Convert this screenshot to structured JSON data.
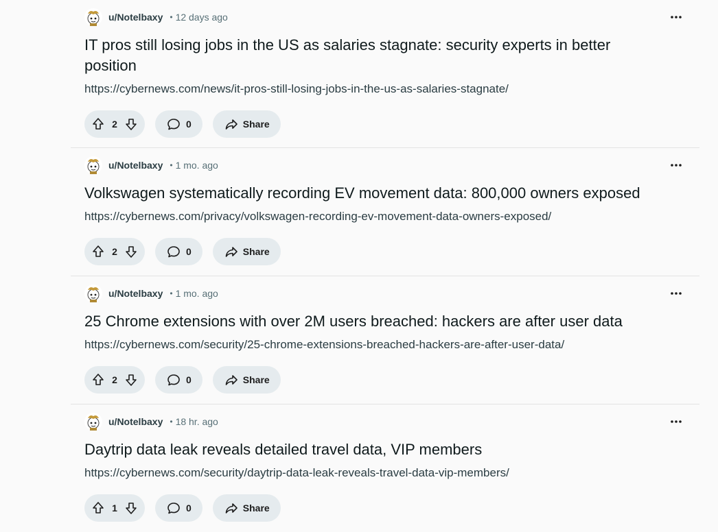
{
  "posts": [
    {
      "author": "u/Notelbaxy",
      "separator": "•",
      "time": "12 days ago",
      "title": "IT pros still losing jobs in the US as salaries stagnate: security experts in better position",
      "url": "https://cybernews.com/news/it-pros-still-losing-jobs-in-the-us-as-salaries-stagnate/",
      "votes": "2",
      "comments": "0",
      "share_label": "Share",
      "more": "•••"
    },
    {
      "author": "u/Notelbaxy",
      "separator": "•",
      "time": "1 mo. ago",
      "title": "Volkswagen systematically recording EV movement data: 800,000 owners exposed",
      "url": "https://cybernews.com/privacy/volkswagen-recording-ev-movement-data-owners-exposed/",
      "votes": "2",
      "comments": "0",
      "share_label": "Share",
      "more": "•••"
    },
    {
      "author": "u/Notelbaxy",
      "separator": "•",
      "time": "1 mo. ago",
      "title": "25 Chrome extensions with over 2M users breached: hackers are after user data",
      "url": "https://cybernews.com/security/25-chrome-extensions-breached-hackers-are-after-user-data/",
      "votes": "2",
      "comments": "0",
      "share_label": "Share",
      "more": "•••"
    },
    {
      "author": "u/Notelbaxy",
      "separator": "•",
      "time": "18 hr. ago",
      "title": "Daytrip data leak reveals detailed travel data, VIP members",
      "url": "https://cybernews.com/security/daytrip-data-leak-reveals-travel-data-vip-members/",
      "votes": "1",
      "comments": "0",
      "share_label": "Share",
      "more": "•••"
    }
  ],
  "colors": {
    "background": "#fafafa",
    "pill": "#e5ebee",
    "meta_text": "#576f76",
    "divider": "#e3e3e3"
  }
}
